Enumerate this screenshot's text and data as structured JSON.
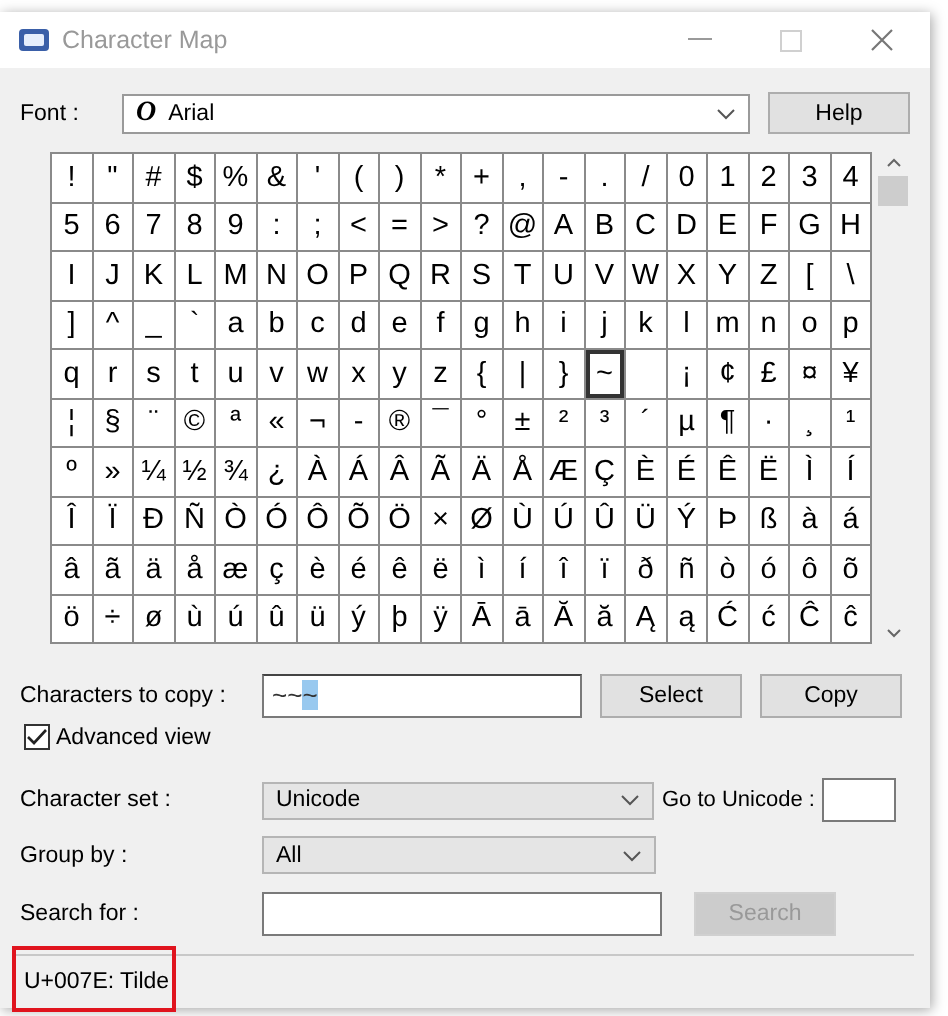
{
  "window": {
    "title": "Character Map"
  },
  "font": {
    "label": "Font :",
    "value": "Arial",
    "glyph": "O"
  },
  "help_button": {
    "label": "Help"
  },
  "grid": [
    [
      {
        "char": "!",
        "selected": false
      },
      {
        "char": "\"",
        "selected": false
      },
      {
        "char": "#",
        "selected": false
      },
      {
        "char": "$",
        "selected": false
      },
      {
        "char": "%",
        "selected": false
      },
      {
        "char": "&",
        "selected": false
      },
      {
        "char": "'",
        "selected": false
      },
      {
        "char": "(",
        "selected": false
      },
      {
        "char": ")",
        "selected": false
      },
      {
        "char": "*",
        "selected": false
      },
      {
        "char": "+",
        "selected": false
      },
      {
        "char": ",",
        "selected": false
      },
      {
        "char": "-",
        "selected": false
      },
      {
        "char": ".",
        "selected": false
      },
      {
        "char": "/",
        "selected": false
      },
      {
        "char": "0",
        "selected": false
      },
      {
        "char": "1",
        "selected": false
      },
      {
        "char": "2",
        "selected": false
      },
      {
        "char": "3",
        "selected": false
      },
      {
        "char": "4",
        "selected": false
      }
    ],
    [
      {
        "char": "5",
        "selected": false
      },
      {
        "char": "6",
        "selected": false
      },
      {
        "char": "7",
        "selected": false
      },
      {
        "char": "8",
        "selected": false
      },
      {
        "char": "9",
        "selected": false
      },
      {
        "char": ":",
        "selected": false
      },
      {
        "char": ";",
        "selected": false
      },
      {
        "char": "<",
        "selected": false
      },
      {
        "char": "=",
        "selected": false
      },
      {
        "char": ">",
        "selected": false
      },
      {
        "char": "?",
        "selected": false
      },
      {
        "char": "@",
        "selected": false
      },
      {
        "char": "A",
        "selected": false
      },
      {
        "char": "B",
        "selected": false
      },
      {
        "char": "C",
        "selected": false
      },
      {
        "char": "D",
        "selected": false
      },
      {
        "char": "E",
        "selected": false
      },
      {
        "char": "F",
        "selected": false
      },
      {
        "char": "G",
        "selected": false
      },
      {
        "char": "H",
        "selected": false
      }
    ],
    [
      {
        "char": "I",
        "selected": false
      },
      {
        "char": "J",
        "selected": false
      },
      {
        "char": "K",
        "selected": false
      },
      {
        "char": "L",
        "selected": false
      },
      {
        "char": "M",
        "selected": false
      },
      {
        "char": "N",
        "selected": false
      },
      {
        "char": "O",
        "selected": false
      },
      {
        "char": "P",
        "selected": false
      },
      {
        "char": "Q",
        "selected": false
      },
      {
        "char": "R",
        "selected": false
      },
      {
        "char": "S",
        "selected": false
      },
      {
        "char": "T",
        "selected": false
      },
      {
        "char": "U",
        "selected": false
      },
      {
        "char": "V",
        "selected": false
      },
      {
        "char": "W",
        "selected": false
      },
      {
        "char": "X",
        "selected": false
      },
      {
        "char": "Y",
        "selected": false
      },
      {
        "char": "Z",
        "selected": false
      },
      {
        "char": "[",
        "selected": false
      },
      {
        "char": "\\",
        "selected": false
      }
    ],
    [
      {
        "char": "]",
        "selected": false
      },
      {
        "char": "^",
        "selected": false
      },
      {
        "char": "_",
        "selected": false
      },
      {
        "char": "`",
        "selected": false
      },
      {
        "char": "a",
        "selected": false
      },
      {
        "char": "b",
        "selected": false
      },
      {
        "char": "c",
        "selected": false
      },
      {
        "char": "d",
        "selected": false
      },
      {
        "char": "e",
        "selected": false
      },
      {
        "char": "f",
        "selected": false
      },
      {
        "char": "g",
        "selected": false
      },
      {
        "char": "h",
        "selected": false
      },
      {
        "char": "i",
        "selected": false
      },
      {
        "char": "j",
        "selected": false
      },
      {
        "char": "k",
        "selected": false
      },
      {
        "char": "l",
        "selected": false
      },
      {
        "char": "m",
        "selected": false
      },
      {
        "char": "n",
        "selected": false
      },
      {
        "char": "o",
        "selected": false
      },
      {
        "char": "p",
        "selected": false
      }
    ],
    [
      {
        "char": "q",
        "selected": false
      },
      {
        "char": "r",
        "selected": false
      },
      {
        "char": "s",
        "selected": false
      },
      {
        "char": "t",
        "selected": false
      },
      {
        "char": "u",
        "selected": false
      },
      {
        "char": "v",
        "selected": false
      },
      {
        "char": "w",
        "selected": false
      },
      {
        "char": "x",
        "selected": false
      },
      {
        "char": "y",
        "selected": false
      },
      {
        "char": "z",
        "selected": false
      },
      {
        "char": "{",
        "selected": false
      },
      {
        "char": "|",
        "selected": false
      },
      {
        "char": "}",
        "selected": false
      },
      {
        "char": "~",
        "selected": true
      },
      {
        "selected": false
      },
      {
        "char": "¡",
        "selected": false
      },
      {
        "char": "¢",
        "selected": false
      },
      {
        "char": "£",
        "selected": false
      },
      {
        "char": "¤",
        "selected": false
      },
      {
        "char": "¥",
        "selected": false
      }
    ],
    [
      {
        "char": "¦",
        "selected": false
      },
      {
        "char": "§",
        "selected": false
      },
      {
        "char": "¨",
        "selected": false
      },
      {
        "char": "©",
        "selected": false
      },
      {
        "char": "ª",
        "selected": false
      },
      {
        "char": "«",
        "selected": false
      },
      {
        "char": "¬",
        "selected": false
      },
      {
        "char": "-",
        "selected": false
      },
      {
        "char": "®",
        "selected": false
      },
      {
        "char": "¯",
        "selected": false
      },
      {
        "char": "°",
        "selected": false
      },
      {
        "char": "±",
        "selected": false
      },
      {
        "char": "²",
        "selected": false
      },
      {
        "char": "³",
        "selected": false
      },
      {
        "char": "´",
        "selected": false
      },
      {
        "char": "µ",
        "selected": false
      },
      {
        "char": "¶",
        "selected": false
      },
      {
        "char": "·",
        "selected": false
      },
      {
        "char": "¸",
        "selected": false
      },
      {
        "char": "¹",
        "selected": false
      }
    ],
    [
      {
        "char": "º",
        "selected": false
      },
      {
        "char": "»",
        "selected": false
      },
      {
        "char": "¼",
        "selected": false
      },
      {
        "char": "½",
        "selected": false
      },
      {
        "char": "¾",
        "selected": false
      },
      {
        "char": "¿",
        "selected": false
      },
      {
        "char": "À",
        "selected": false
      },
      {
        "char": "Á",
        "selected": false
      },
      {
        "char": "Â",
        "selected": false
      },
      {
        "char": "Ã",
        "selected": false
      },
      {
        "char": "Ä",
        "selected": false
      },
      {
        "char": "Å",
        "selected": false
      },
      {
        "char": "Æ",
        "selected": false
      },
      {
        "char": "Ç",
        "selected": false
      },
      {
        "char": "È",
        "selected": false
      },
      {
        "char": "É",
        "selected": false
      },
      {
        "char": "Ê",
        "selected": false
      },
      {
        "char": "Ë",
        "selected": false
      },
      {
        "char": "Ì",
        "selected": false
      },
      {
        "char": "Í",
        "selected": false
      }
    ],
    [
      {
        "char": "Î",
        "selected": false
      },
      {
        "char": "Ï",
        "selected": false
      },
      {
        "char": "Ð",
        "selected": false
      },
      {
        "char": "Ñ",
        "selected": false
      },
      {
        "char": "Ò",
        "selected": false
      },
      {
        "char": "Ó",
        "selected": false
      },
      {
        "char": "Ô",
        "selected": false
      },
      {
        "char": "Õ",
        "selected": false
      },
      {
        "char": "Ö",
        "selected": false
      },
      {
        "char": "×",
        "selected": false
      },
      {
        "char": "Ø",
        "selected": false
      },
      {
        "char": "Ù",
        "selected": false
      },
      {
        "char": "Ú",
        "selected": false
      },
      {
        "char": "Û",
        "selected": false
      },
      {
        "char": "Ü",
        "selected": false
      },
      {
        "char": "Ý",
        "selected": false
      },
      {
        "char": "Þ",
        "selected": false
      },
      {
        "char": "ß",
        "selected": false
      },
      {
        "char": "à",
        "selected": false
      },
      {
        "char": "á",
        "selected": false
      }
    ],
    [
      {
        "char": "â",
        "selected": false
      },
      {
        "char": "ã",
        "selected": false
      },
      {
        "char": "ä",
        "selected": false
      },
      {
        "char": "å",
        "selected": false
      },
      {
        "char": "æ",
        "selected": false
      },
      {
        "char": "ç",
        "selected": false
      },
      {
        "char": "è",
        "selected": false
      },
      {
        "char": "é",
        "selected": false
      },
      {
        "char": "ê",
        "selected": false
      },
      {
        "char": "ë",
        "selected": false
      },
      {
        "char": "ì",
        "selected": false
      },
      {
        "char": "í",
        "selected": false
      },
      {
        "char": "î",
        "selected": false
      },
      {
        "char": "ï",
        "selected": false
      },
      {
        "char": "ð",
        "selected": false
      },
      {
        "char": "ñ",
        "selected": false
      },
      {
        "char": "ò",
        "selected": false
      },
      {
        "char": "ó",
        "selected": false
      },
      {
        "char": "ô",
        "selected": false
      },
      {
        "char": "õ",
        "selected": false
      }
    ],
    [
      {
        "char": "ö",
        "selected": false
      },
      {
        "char": "÷",
        "selected": false
      },
      {
        "char": "ø",
        "selected": false
      },
      {
        "char": "ù",
        "selected": false
      },
      {
        "char": "ú",
        "selected": false
      },
      {
        "char": "û",
        "selected": false
      },
      {
        "char": "ü",
        "selected": false
      },
      {
        "char": "ý",
        "selected": false
      },
      {
        "char": "þ",
        "selected": false
      },
      {
        "char": "ÿ",
        "selected": false
      },
      {
        "char": "Ā",
        "selected": false
      },
      {
        "char": "ā",
        "selected": false
      },
      {
        "char": "Ă",
        "selected": false
      },
      {
        "char": "ă",
        "selected": false
      },
      {
        "char": "Ą",
        "selected": false
      },
      {
        "char": "ą",
        "selected": false
      },
      {
        "char": "Ć",
        "selected": false
      },
      {
        "char": "ć",
        "selected": false
      },
      {
        "char": "Ĉ",
        "selected": false
      },
      {
        "char": "ĉ",
        "selected": false
      }
    ]
  ],
  "copy": {
    "label": "Characters to copy :",
    "value": "~~",
    "selected_text": "~"
  },
  "select_button": {
    "label": "Select"
  },
  "copy_button": {
    "label": "Copy"
  },
  "advanced_view": {
    "label": "Advanced view",
    "checked": true
  },
  "character_set": {
    "label": "Character set :",
    "value": "Unicode"
  },
  "go_to_unicode": {
    "label": "Go to Unicode :"
  },
  "group_by": {
    "label": "Group by :",
    "value": "All"
  },
  "search": {
    "label": "Search for :"
  },
  "search_button": {
    "label": "Search",
    "disabled": true
  },
  "status_bar": {
    "text": "U+007E: Tilde"
  }
}
